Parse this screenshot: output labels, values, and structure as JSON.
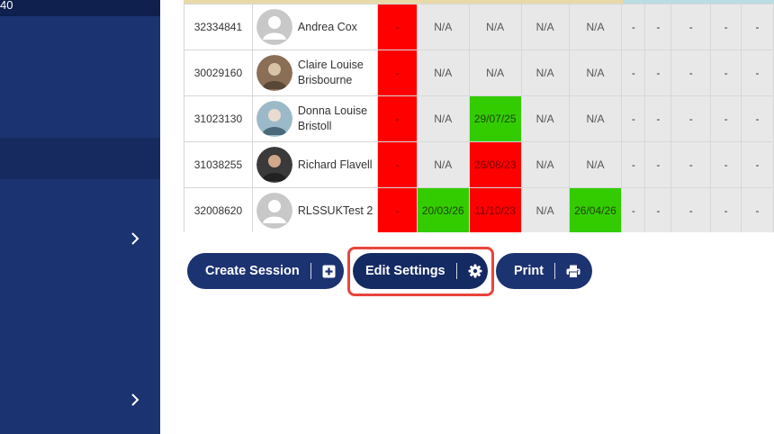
{
  "sidebar": {
    "top_label": "40"
  },
  "table": {
    "rows": [
      {
        "id": "32334841",
        "name": "Andrea Cox",
        "avatar": "default",
        "cells": [
          {
            "text": "-",
            "status": "red"
          },
          {
            "text": "N/A",
            "status": "grey"
          },
          {
            "text": "N/A",
            "status": "grey"
          },
          {
            "text": "N/A",
            "status": "grey"
          },
          {
            "text": "N/A",
            "status": "grey"
          },
          {
            "text": "-",
            "status": "dash"
          },
          {
            "text": "-",
            "status": "dash"
          },
          {
            "text": "-",
            "status": "dash"
          },
          {
            "text": "-",
            "status": "dash"
          },
          {
            "text": "-",
            "status": "dash"
          }
        ]
      },
      {
        "id": "30029160",
        "name": "Claire Louise Brisbourne",
        "avatar": "photo",
        "cells": [
          {
            "text": "-",
            "status": "red"
          },
          {
            "text": "N/A",
            "status": "grey"
          },
          {
            "text": "N/A",
            "status": "grey"
          },
          {
            "text": "N/A",
            "status": "grey"
          },
          {
            "text": "N/A",
            "status": "grey"
          },
          {
            "text": "-",
            "status": "dash"
          },
          {
            "text": "-",
            "status": "dash"
          },
          {
            "text": "-",
            "status": "dash"
          },
          {
            "text": "-",
            "status": "dash"
          },
          {
            "text": "-",
            "status": "dash"
          }
        ]
      },
      {
        "id": "31023130",
        "name": "Donna Louise Bristoll",
        "avatar": "photo",
        "cells": [
          {
            "text": "-",
            "status": "red"
          },
          {
            "text": "N/A",
            "status": "grey"
          },
          {
            "text": "29/07/25",
            "status": "green"
          },
          {
            "text": "N/A",
            "status": "grey"
          },
          {
            "text": "N/A",
            "status": "grey"
          },
          {
            "text": "-",
            "status": "dash"
          },
          {
            "text": "-",
            "status": "dash"
          },
          {
            "text": "-",
            "status": "dash"
          },
          {
            "text": "-",
            "status": "dash"
          },
          {
            "text": "-",
            "status": "dash"
          }
        ]
      },
      {
        "id": "31038255",
        "name": "Richard Flavell",
        "avatar": "photo",
        "cells": [
          {
            "text": "-",
            "status": "red"
          },
          {
            "text": "N/A",
            "status": "grey"
          },
          {
            "text": "26/08/23",
            "status": "red"
          },
          {
            "text": "N/A",
            "status": "grey"
          },
          {
            "text": "N/A",
            "status": "grey"
          },
          {
            "text": "-",
            "status": "dash"
          },
          {
            "text": "-",
            "status": "dash"
          },
          {
            "text": "-",
            "status": "dash"
          },
          {
            "text": "-",
            "status": "dash"
          },
          {
            "text": "-",
            "status": "dash"
          }
        ]
      },
      {
        "id": "32008620",
        "name": "RLSSUKTest 2",
        "avatar": "default",
        "cells": [
          {
            "text": "-",
            "status": "red"
          },
          {
            "text": "20/03/26",
            "status": "green"
          },
          {
            "text": "11/10/23",
            "status": "red"
          },
          {
            "text": "N/A",
            "status": "grey"
          },
          {
            "text": "26/04/26",
            "status": "green"
          },
          {
            "text": "-",
            "status": "dash"
          },
          {
            "text": "-",
            "status": "dash"
          },
          {
            "text": "-",
            "status": "dash"
          },
          {
            "text": "-",
            "status": "dash"
          },
          {
            "text": "-",
            "status": "dash"
          }
        ]
      }
    ]
  },
  "actions": {
    "create_session": "Create Session",
    "edit_settings": "Edit Settings",
    "print": "Print"
  },
  "colors": {
    "sidebar": "#1c3372",
    "button": "#1c3372",
    "status_red": "#ff0000",
    "status_green": "#33cc00",
    "status_grey": "#e8e8e8",
    "highlight": "#e8453c"
  },
  "icons": {
    "create_session": "plus-square-icon",
    "edit_settings": "gear-icon",
    "print": "printer-icon",
    "sidebar_expand": "chevron-right-icon"
  }
}
